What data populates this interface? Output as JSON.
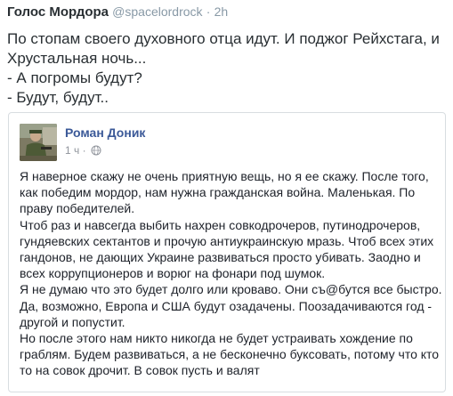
{
  "tweet": {
    "display_name": "Голос Мордора",
    "handle": "@spacelordrock",
    "separator": "·",
    "time": "2h",
    "lines": [
      "По стопам своего духовного отца идут. И поджог Рейхстага, и",
      "Хрустальная ночь...",
      "- А погромы будут?",
      "- Будут, будут.."
    ]
  },
  "quoted_post": {
    "author": "Роман Доник",
    "time": "1 ч",
    "separator": "·",
    "privacy_icon": "globe-icon",
    "body_lines": [
      "Я наверное скажу не очень приятную вещь, но я ее скажу. После того,",
      "как победим мордор, нам нужна гражданская война. Маленькая. По",
      "праву победителей.",
      "Чтоб раз и навсегда выбить нахрен совкодрочеров, путинодрочеров,",
      "гундяевских сектантов и прочую антиукраинскую мразь. Чтоб всех этих",
      "гандонов, не дающих Украине развиваться просто убивать. Заодно и",
      "всех коррупционеров и ворюг на фонари под шумок.",
      "Я не думаю что это будет долго или кроваво. Они съ@бутся все быстро.",
      "Да, возможно, Европа и США будут озадачены. Поозадачиваются год -",
      "другой и попустит.",
      "Но после этого нам никто никогда не будет устраивать хождение по",
      "граблям. Будем развиваться, а не бесконечно буксовать, потому что кто",
      "то на совок дрочит. В совок пусть и валят"
    ]
  },
  "colors": {
    "tweet_text": "#292f33",
    "muted": "#8899a6",
    "fb_name": "#3b5998",
    "fb_meta": "#90949c",
    "card_border": "#d8dde1"
  }
}
